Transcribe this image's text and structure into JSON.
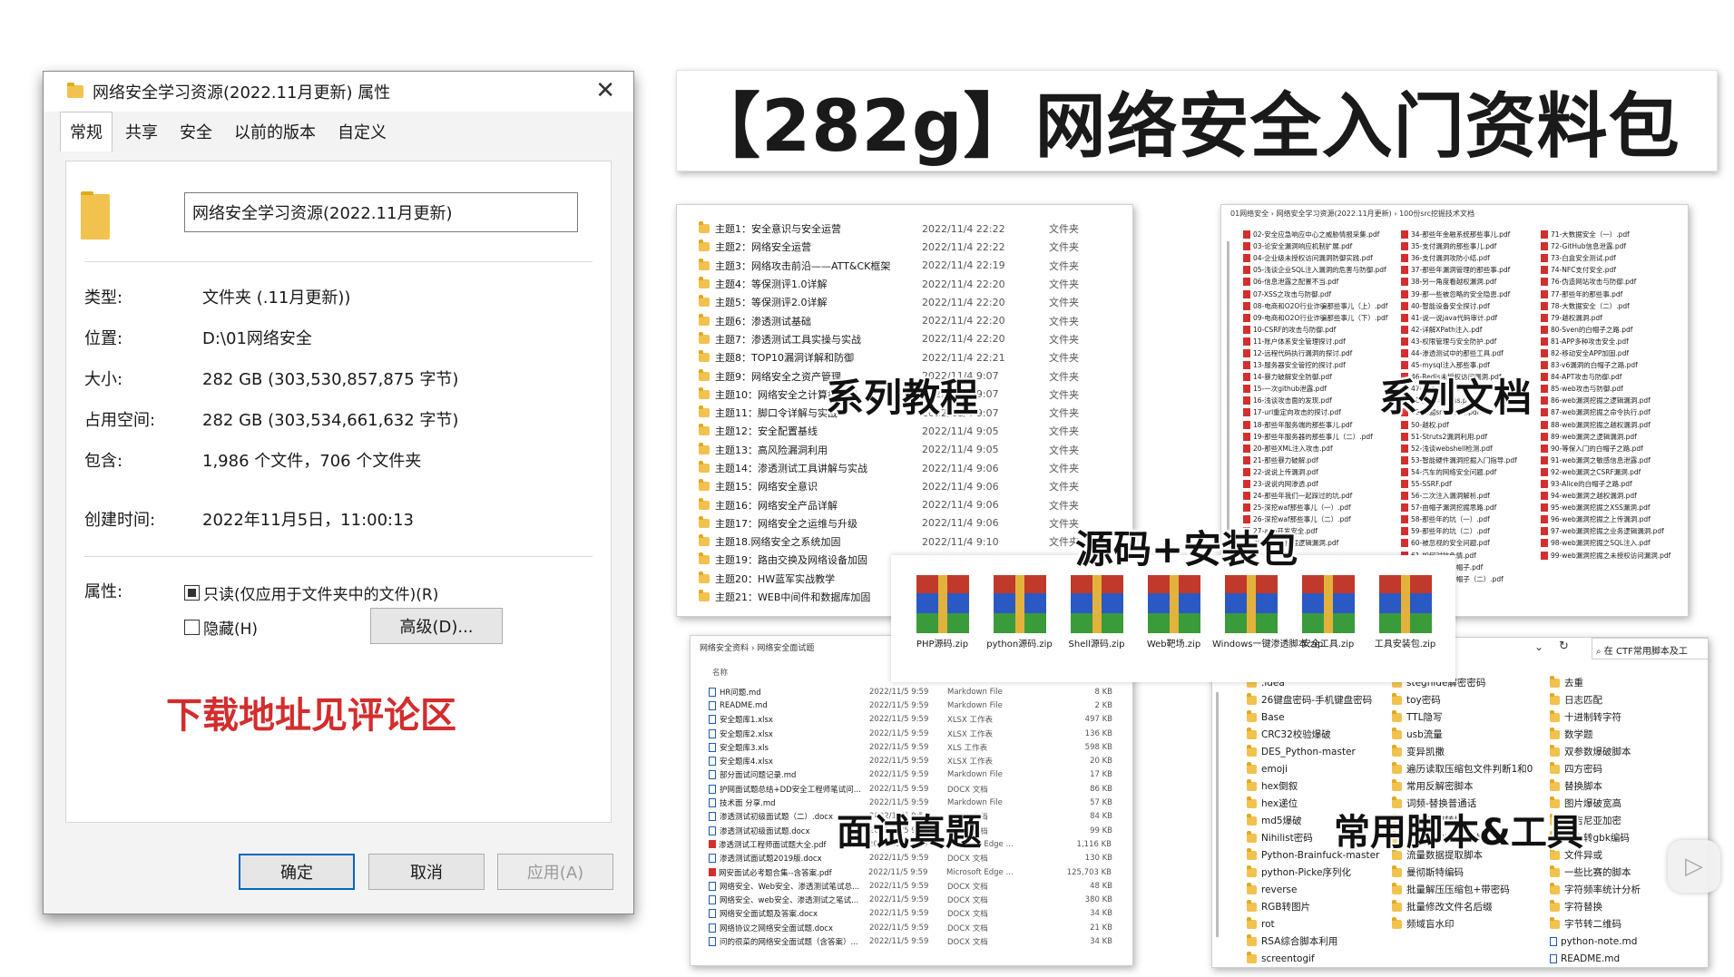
{
  "dialog": {
    "title": "网络安全学习资源(2022.11月更新) 属性",
    "tabs": [
      "常规",
      "共享",
      "安全",
      "以前的版本",
      "自定义"
    ],
    "name": "网络安全学习资源(2022.11月更新)",
    "fields": [
      {
        "label": "类型:",
        "value": "文件夹 (.11月更新))"
      },
      {
        "label": "位置:",
        "value": "D:\\01网络安全"
      },
      {
        "label": "大小:",
        "value": "282 GB (303,530,857,875 字节)"
      },
      {
        "label": "占用空间:",
        "value": "282 GB (303,534,661,632 字节)"
      },
      {
        "label": "包含:",
        "value": "1,986 个文件，706 个文件夹"
      },
      {
        "label": "创建时间:",
        "value": "2022年11月5日，11:00:13"
      }
    ],
    "attr_label": "属性:",
    "readonly": "只读(仅应用于文件夹中的文件)(R)",
    "hidden": "隐藏(H)",
    "advanced": "高级(D)...",
    "download_note": "下载地址见评论区",
    "ok": "确定",
    "cancel": "取消",
    "apply": "应用(A)"
  },
  "banner": "【282g】网络安全入门资料包",
  "captions": {
    "tutorials": "系列教程",
    "docs": "系列文档",
    "source": "源码+安装包",
    "interview": "面试真题",
    "tools": "常用脚本&工具"
  },
  "tutorials": {
    "type_label": "文件夹",
    "rows": [
      [
        "主题1：安全意识与安全运营",
        "2022/11/4 22:22"
      ],
      [
        "主题2：网络安全运营",
        "2022/11/4 22:22"
      ],
      [
        "主题3：网络攻击前沿——ATT&CK框架",
        "2022/11/4 22:19"
      ],
      [
        "主题4：等保测评1.0详解",
        "2022/11/4 22:20"
      ],
      [
        "主题5：等保测评2.0详解",
        "2022/11/4 22:20"
      ],
      [
        "主题6：渗透测试基础",
        "2022/11/4 22:20"
      ],
      [
        "主题7：渗透测试工具实操与实战",
        "2022/11/4 22:20"
      ],
      [
        "主题8：TOP10漏洞详解和防御",
        "2022/11/4 22:21"
      ],
      [
        "主题9：网络安全之资产管理",
        "2022/11/4 9:07"
      ],
      [
        "主题10：网络安全之计算机基础",
        "2022/11/4 9:07"
      ],
      [
        "主题11：脚口令详解与实战",
        "2022/11/4 9:07"
      ],
      [
        "主题12：安全配置基线",
        "2022/11/4 9:05"
      ],
      [
        "主题13：高风险漏洞利用",
        "2022/11/4 9:05"
      ],
      [
        "主题14：渗透测试工具讲解与实战",
        "2022/11/4 9:06"
      ],
      [
        "主题15：网络安全意识",
        "2022/11/4 9:06"
      ],
      [
        "主题16：网络安全产品详解",
        "2022/11/4 9:06"
      ],
      [
        "主题17：网络安全之运维与升级",
        "2022/11/4 9:06"
      ],
      [
        "主题18.网络安全之系统加固",
        "2022/11/4 9:10"
      ],
      [
        "主题19：路由交换及网络设备加固",
        ""
      ],
      [
        "主题20：HW蓝军实战教学",
        ""
      ],
      [
        "主题21：WEB中间件和数据库加固",
        ""
      ]
    ]
  },
  "docs": {
    "breadcrumb": "01网络安全 › 网络安全学习资源(2022.11月更新) › 100份src挖掘技术文档",
    "col1": [
      "02-安全应急响应中心之威胁情报采集.pdf",
      "03-论安全漏洞响应机制扩展.pdf",
      "04-企业级未授权访问漏洞防御实践.pdf",
      "05-浅谈企业SQL注入漏洞的危害与防御.pdf",
      "06-信息泄露之配置不当.pdf",
      "07-XSS之攻击与防御.pdf",
      "08-电商和O2O行业诈骗那些事儿（上）.pdf",
      "09-电商和O2O行业诈骗那些事儿（下）.pdf",
      "10-CSRF的攻击与防御.pdf",
      "11-账户体系安全管理探讨.pdf",
      "12-远程代码执行漏洞的探讨.pdf",
      "13-服务器安全管控的探讨.pdf",
      "14-暴力破解安全防御.pdf",
      "15-一次github泄露.pdf",
      "16-浅谈攻击面的发现.pdf",
      "17-url重定向攻击的探讨.pdf",
      "18-那些年服务端的那些事儿.pdf",
      "19-那些年服务器的那些事儿（二）.pdf",
      "20-那些XML注入攻击.pdf",
      "21-那些暴力破解.pdf",
      "22-说说上传漏洞.pdf",
      "23-说说内网渗透.pdf",
      "24-那些年我们一起踩过的坑.pdf",
      "25-深挖waf那些事儿（一）.pdf",
      "26-深挖waf那些事儿（二）.pdf",
      "27-app开发安全.pdf",
      "28-那些年挖掘逻辑漏洞.pdf"
    ],
    "col2": [
      "34-那些年金融系统那些事儿.pdf",
      "35-支付漏洞的那些事儿.pdf",
      "36-支付漏洞攻防小结.pdf",
      "37-那些年漏洞管理的那些事.pdf",
      "38-另一角度看越权漏洞.pdf",
      "39-那一些被忽略的安全隐患.pdf",
      "40-智能设备安全探讨.pdf",
      "41-说一说java代码审计.pdf",
      "42-详解XPath注入.pdf",
      "43-权限管理与安全防护.pdf",
      "44-渗透测试中的那些工具.pdf",
      "45-mysql注入那些事.pdf",
      "46-Redis未授权访问漏洞.pdf",
      "47-组件漏洞.pdf",
      "48-那些年的xss.pdf",
      "49-挖掘src的思路.pdf",
      "50-越权.pdf",
      "51-Struts2漏洞利用.pdf",
      "52-浅谈webshell检测.pdf",
      "53-智能硬件漏洞挖掘入门指导.pdf",
      "54-汽车的网络安全问题.pdf",
      "55-SSRF.pdf",
      "56-二次注入漏洞解析.pdf",
      "57-由帽子漏洞挖掘思路.pdf",
      "58-那些年的坑（一）.pdf",
      "59-那些年的坑（二）.pdf",
      "60-被忽视的安全问题.pdf",
      "61-如何对抗色情.pdf",
      "62-那些年的白帽子.pdf",
      "64-那些年的白帽子（二）.pdf"
    ],
    "col3": [
      "71-大数据安全（一）.pdf",
      "72-GitHub信息泄露.pdf",
      "73-白盒安全测试.pdf",
      "74-NFC支付安全.pdf",
      "76-伪造网站攻击与防御.pdf",
      "77-那些年的那些事.pdf",
      "78-大数据安全（二）.pdf",
      "79-越权漏洞.pdf",
      "80-Sven的白帽子之路.pdf",
      "81-APP多种攻击安全.pdf",
      "82-移动安全APP加固.pdf",
      "83-v6漏洞的白帽子之路.pdf",
      "84-APT攻击与防御.pdf",
      "85-web攻击与防御.pdf",
      "86-web漏洞挖掘之逻辑漏洞.pdf",
      "87-web漏洞挖掘之命令执行.pdf",
      "88-web漏洞挖掘之越权漏洞.pdf",
      "89-web漏洞之逻辑漏洞.pdf",
      "90-等保入门的白帽子之路.pdf",
      "91-web漏洞之敏感信息泄露.pdf",
      "92-web漏洞之CSRF漏洞.pdf",
      "93-Alice的白帽子之路.pdf",
      "94-web漏洞之越权漏洞.pdf",
      "95-web漏洞挖掘之XSS漏洞.pdf",
      "96-web漏洞挖掘之上传漏洞.pdf",
      "97-web漏洞挖掘之业务逻辑漏洞.pdf",
      "98-web漏洞挖掘之SQL注入.pdf",
      "99-web漏洞挖掘之未授权访问漏洞.pdf"
    ]
  },
  "source": {
    "zips": [
      "PHP源码.zip",
      "python源码.zip",
      "Shell源码.zip",
      "Web靶场.zip",
      "Windows一键渗透脚本.zip",
      "安全工具.zip",
      "工具安装包.zip"
    ]
  },
  "interview": {
    "breadcrumb": "网络安全资料 › 网络安全面试题",
    "col_name": "名称",
    "rows": [
      [
        "HR问题.md",
        "2022/11/5 9:59",
        "Markdown File",
        "8 KB"
      ],
      [
        "README.md",
        "2022/11/5 9:59",
        "Markdown File",
        "2 KB"
      ],
      [
        "安全题库1.xlsx",
        "2022/11/5 9:59",
        "XLSX 工作表",
        "497 KB"
      ],
      [
        "安全题库2.xlsx",
        "2022/11/5 9:59",
        "XLSX 工作表",
        "136 KB"
      ],
      [
        "安全题库3.xls",
        "2022/11/5 9:59",
        "XLS 工作表",
        "598 KB"
      ],
      [
        "安全题库4.xlsx",
        "2022/11/5 9:59",
        "XLSX 工作表",
        "20 KB"
      ],
      [
        "部分面试问题记录.md",
        "2022/11/5 9:59",
        "Markdown File",
        "17 KB"
      ],
      [
        "护网面试题总结+DD安全工程师笔试问...",
        "2022/11/5 9:59",
        "DOCX 文档",
        "86 KB"
      ],
      [
        "技术面 分享.md",
        "2022/11/5 9:59",
        "Markdown File",
        "57 KB"
      ],
      [
        "渗透测试初级面试题（二）.docx",
        "2022/11/5 9:59",
        "DOCX 文档",
        "84 KB"
      ],
      [
        "渗透测试初级面试题.docx",
        "2022/11/5 9:59",
        "DOCX 文档",
        "99 KB"
      ],
      [
        "渗透测试工程师面试题大全.pdf",
        "2022/11/5 9:59",
        "Microsoft Edge ...",
        "1,116 KB"
      ],
      [
        "渗透测试面试题2019版.docx",
        "2022/11/5 9:59",
        "DOCX 文档",
        "130 KB"
      ],
      [
        "网安面试必考题合集--含答案.pdf",
        "2022/11/5 9:59",
        "Microsoft Edge ...",
        "125,703 KB"
      ],
      [
        "网络安全、Web安全、渗透测试笔试总...",
        "2022/11/5 9:59",
        "DOCX 文档",
        "48 KB"
      ],
      [
        "网络安全、web安全、渗透测试之笔试...",
        "2022/11/5 9:59",
        "DOCX 文档",
        "380 KB"
      ],
      [
        "网络安全面试题及答案.docx",
        "2022/11/5 9:59",
        "DOCX 文档",
        "34 KB"
      ],
      [
        "网络协议之网络安全面试题.docx",
        "2022/11/5 9:59",
        "DOCX 文档",
        "21 KB"
      ],
      [
        "问的很菜的网络安全面试题（含答案）...",
        "2022/11/5 9:59",
        "DOCX 文档",
        "34 KB"
      ]
    ]
  },
  "tools": {
    "search": "在 CTF常用脚本及工",
    "col1": [
      ".idea",
      "26键盘密码-手机键盘密码",
      "Base",
      "CRC32校验爆破",
      "DES_Python-master",
      "emoji",
      "hex倒叙",
      "hex递位",
      "md5爆破",
      "Nihilist密码",
      "Python-Brainfuck-master",
      "python-Picke序列化",
      "reverse",
      "RGB转图片",
      "rot",
      "RSA综合脚本利用",
      "screentogif"
    ],
    "col2": [
      "stegnide解密密码",
      "toy密码",
      "TTL隐写",
      "usb流量",
      "变异凯撒",
      "遍历读取压缩包文件判断1和0",
      "常用反解密脚本",
      "词频-替换普通话",
      "进制互相转换",
      "进制转化字符脚本",
      "流量数据提取脚本",
      "曼彻斯特编码",
      "批量解压压缩包+带密码",
      "批量修改文件名后缀",
      "频域盲水印"
    ],
    "col3": [
      "去重",
      "日志匹配",
      "十进制转字符",
      "数学题",
      "双参数爆破脚本",
      "四方密码",
      "替换脚本",
      "图片爆破宽高",
      "维吉尼亚加密",
      "文本转gbk编码",
      "文件异或",
      "一些比赛的脚本",
      "字符频率统计分析",
      "字符替换",
      "字节转二维码",
      "python-note.md",
      "README.md"
    ]
  },
  "colors": {
    "accent_red": "#d32d2d",
    "folder": "#f2c24f",
    "primary_btn": "#0067c0"
  }
}
